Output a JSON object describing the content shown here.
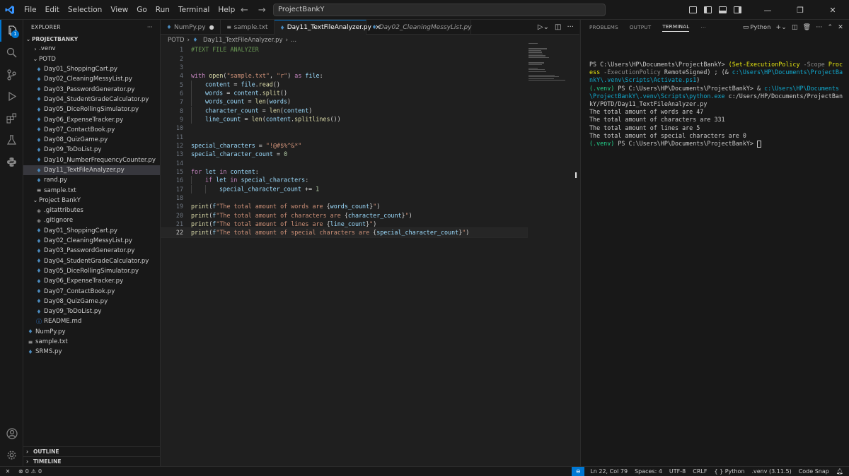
{
  "titlebar": {
    "menus": [
      "File",
      "Edit",
      "Selection",
      "View",
      "Go",
      "Run",
      "Terminal",
      "Help"
    ],
    "search": "ProjectBankY",
    "back_icon": "←",
    "forward_icon": "→"
  },
  "activity": {
    "badge": "1"
  },
  "explorer": {
    "header": "EXPLORER",
    "more": "···",
    "root": "PROJECTBANKY",
    "items": [
      {
        "label": ".venv",
        "indent": 1,
        "type": "folder",
        "open": false
      },
      {
        "label": "POTD",
        "indent": 1,
        "type": "folder",
        "open": true
      },
      {
        "label": "Day01_ShoppingCart.py",
        "indent": 2,
        "type": "py"
      },
      {
        "label": "Day02_CleaningMessyList.py",
        "indent": 2,
        "type": "py"
      },
      {
        "label": "Day03_PasswordGenerator.py",
        "indent": 2,
        "type": "py"
      },
      {
        "label": "Day04_StudentGradeCalculator.py",
        "indent": 2,
        "type": "py"
      },
      {
        "label": "Day05_DiceRollingSimulator.py",
        "indent": 2,
        "type": "py"
      },
      {
        "label": "Day06_ExpenseTracker.py",
        "indent": 2,
        "type": "py"
      },
      {
        "label": "Day07_ContactBook.py",
        "indent": 2,
        "type": "py"
      },
      {
        "label": "Day08_QuizGame.py",
        "indent": 2,
        "type": "py"
      },
      {
        "label": "Day09_ToDoList.py",
        "indent": 2,
        "type": "py"
      },
      {
        "label": "Day10_NumberFrequencyCounter.py",
        "indent": 2,
        "type": "py"
      },
      {
        "label": "Day11_TextFileAnalyzer.py",
        "indent": 2,
        "type": "py",
        "selected": true
      },
      {
        "label": "rand.py",
        "indent": 2,
        "type": "py"
      },
      {
        "label": "sample.txt",
        "indent": 2,
        "type": "txt"
      },
      {
        "label": "Project BankY",
        "indent": 1,
        "type": "folder",
        "open": true
      },
      {
        "label": ".gitattributes",
        "indent": 2,
        "type": "git"
      },
      {
        "label": ".gitignore",
        "indent": 2,
        "type": "git"
      },
      {
        "label": "Day01_ShoppingCart.py",
        "indent": 2,
        "type": "py"
      },
      {
        "label": "Day02_CleaningMessyList.py",
        "indent": 2,
        "type": "py"
      },
      {
        "label": "Day03_PasswordGenerator.py",
        "indent": 2,
        "type": "py"
      },
      {
        "label": "Day04_StudentGradeCalculator.py",
        "indent": 2,
        "type": "py"
      },
      {
        "label": "Day05_DiceRollingSimulator.py",
        "indent": 2,
        "type": "py"
      },
      {
        "label": "Day06_ExpenseTracker.py",
        "indent": 2,
        "type": "py"
      },
      {
        "label": "Day07_ContactBook.py",
        "indent": 2,
        "type": "py"
      },
      {
        "label": "Day08_QuizGame.py",
        "indent": 2,
        "type": "py"
      },
      {
        "label": "Day09_ToDoList.py",
        "indent": 2,
        "type": "py"
      },
      {
        "label": "README.md",
        "indent": 2,
        "type": "info"
      },
      {
        "label": "NumPy.py",
        "indent": 0,
        "type": "py"
      },
      {
        "label": "sample.txt",
        "indent": 0,
        "type": "txt"
      },
      {
        "label": "SRMS.py",
        "indent": 0,
        "type": "py"
      }
    ],
    "outline": "OUTLINE",
    "timeline": "TIMELINE"
  },
  "tabs": [
    {
      "label": "NumPy.py",
      "state": "modified"
    },
    {
      "label": "sample.txt",
      "state": "normal",
      "icon": "txt"
    },
    {
      "label": "Day11_TextFileAnalyzer.py",
      "state": "active"
    },
    {
      "label": "Day02_CleaningMessyList.py",
      "state": "preview"
    }
  ],
  "breadcrumb": {
    "folder": "POTD",
    "file": "Day11_TextFileAnalyzer.py",
    "symbol": "..."
  },
  "code": {
    "current_line": 22,
    "lines": [
      [
        [
          "cmt",
          "#TEXT FILE ANALYZER"
        ]
      ],
      [],
      [],
      [
        [
          "kw",
          "with "
        ],
        [
          "fn",
          "open"
        ],
        [
          "op",
          "("
        ],
        [
          "str",
          "\"sample.txt\""
        ],
        [
          "op",
          ", "
        ],
        [
          "str",
          "\"r\""
        ],
        [
          "op",
          ") "
        ],
        [
          "kw",
          "as "
        ],
        [
          "var",
          "file"
        ],
        [
          "op",
          ":"
        ]
      ],
      [
        [
          "g",
          ""
        ],
        [
          "var",
          "content"
        ],
        [
          "op",
          " = "
        ],
        [
          "var",
          "file"
        ],
        [
          "op",
          "."
        ],
        [
          "fn",
          "read"
        ],
        [
          "op",
          "()"
        ]
      ],
      [
        [
          "g",
          ""
        ],
        [
          "var",
          "words"
        ],
        [
          "op",
          " = "
        ],
        [
          "var",
          "content"
        ],
        [
          "op",
          "."
        ],
        [
          "fn",
          "split"
        ],
        [
          "op",
          "()"
        ]
      ],
      [
        [
          "g",
          ""
        ],
        [
          "var",
          "words_count"
        ],
        [
          "op",
          " = "
        ],
        [
          "fn",
          "len"
        ],
        [
          "op",
          "("
        ],
        [
          "var",
          "words"
        ],
        [
          "op",
          ")"
        ]
      ],
      [
        [
          "g",
          ""
        ],
        [
          "var",
          "character_count"
        ],
        [
          "op",
          " = "
        ],
        [
          "fn",
          "len"
        ],
        [
          "op",
          "("
        ],
        [
          "var",
          "content"
        ],
        [
          "op",
          ")"
        ]
      ],
      [
        [
          "g",
          ""
        ],
        [
          "var",
          "line_count"
        ],
        [
          "op",
          " = "
        ],
        [
          "fn",
          "len"
        ],
        [
          "op",
          "("
        ],
        [
          "var",
          "content"
        ],
        [
          "op",
          "."
        ],
        [
          "fn",
          "splitlines"
        ],
        [
          "op",
          "())"
        ]
      ],
      [],
      [],
      [
        [
          "var",
          "special_characters"
        ],
        [
          "op",
          " = "
        ],
        [
          "str",
          "\"!@#$%^&*\""
        ]
      ],
      [
        [
          "var",
          "special_character_count"
        ],
        [
          "op",
          " = "
        ],
        [
          "num",
          "0"
        ]
      ],
      [],
      [
        [
          "kw",
          "for "
        ],
        [
          "var",
          "let "
        ],
        [
          "kw",
          "in "
        ],
        [
          "var",
          "content"
        ],
        [
          "op",
          ":"
        ]
      ],
      [
        [
          "g",
          ""
        ],
        [
          "kw",
          "if "
        ],
        [
          "var",
          "let "
        ],
        [
          "kw",
          "in "
        ],
        [
          "var",
          "special_characters"
        ],
        [
          "op",
          ":"
        ]
      ],
      [
        [
          "g",
          ""
        ],
        [
          "g",
          ""
        ],
        [
          "var",
          "special_character_count"
        ],
        [
          "op",
          " += "
        ],
        [
          "num",
          "1"
        ]
      ],
      [],
      [
        [
          "fn",
          "print"
        ],
        [
          "op",
          "("
        ],
        [
          "var",
          "f"
        ],
        [
          "str",
          "\"The total amount of words are "
        ],
        [
          "op",
          "{"
        ],
        [
          "var",
          "words_count"
        ],
        [
          "op",
          "}"
        ],
        [
          "str",
          "\""
        ],
        [
          "op",
          ")"
        ]
      ],
      [
        [
          "fn",
          "print"
        ],
        [
          "op",
          "("
        ],
        [
          "var",
          "f"
        ],
        [
          "str",
          "\"The total amount of characters are "
        ],
        [
          "op",
          "{"
        ],
        [
          "var",
          "character_count"
        ],
        [
          "op",
          "}"
        ],
        [
          "str",
          "\""
        ],
        [
          "op",
          ")"
        ]
      ],
      [
        [
          "fn",
          "print"
        ],
        [
          "op",
          "("
        ],
        [
          "var",
          "f"
        ],
        [
          "str",
          "\"The total amount of lines are "
        ],
        [
          "op",
          "{"
        ],
        [
          "var",
          "line_count"
        ],
        [
          "op",
          "}"
        ],
        [
          "str",
          "\""
        ],
        [
          "op",
          ")"
        ]
      ],
      [
        [
          "fn",
          "print"
        ],
        [
          "op",
          "("
        ],
        [
          "var",
          "f"
        ],
        [
          "str",
          "\"The total amount of special characters are "
        ],
        [
          "op",
          "{"
        ],
        [
          "var",
          "special_character_count"
        ],
        [
          "op",
          "}"
        ],
        [
          "str",
          "\""
        ],
        [
          "op",
          ")"
        ]
      ]
    ]
  },
  "panel": {
    "tabs": [
      "PROBLEMS",
      "OUTPUT",
      "TERMINAL",
      "···"
    ],
    "active_tab": "TERMINAL",
    "shell_label": "Python",
    "terminal": [
      [
        [
          "n",
          "PS C:\\Users\\HP\\Documents\\ProjectBankY> "
        ],
        [
          "y",
          "(Set-ExecutionPolicy "
        ],
        [
          "g",
          "-Scope "
        ],
        [
          "y",
          "Process "
        ],
        [
          "g",
          "-ExecutionPolicy "
        ],
        [
          "n",
          "RemoteSigned) ; (& "
        ],
        [
          "c",
          "c:\\Users\\HP\\Documents\\ProjectBankY\\.venv\\Scripts\\Activate.ps1"
        ],
        [
          "n",
          ")"
        ]
      ],
      [
        [
          "gr",
          "(.venv) "
        ],
        [
          "n",
          "PS C:\\Users\\HP\\Documents\\ProjectBankY> & "
        ],
        [
          "c",
          "c:\\Users\\HP\\Documents\\ProjectBankY\\.venv\\Scripts\\python.exe "
        ],
        [
          "n",
          "c:/Users/HP/Documents/ProjectBankY/POTD/Day11_TextFileAnalyzer.py"
        ]
      ],
      [
        [
          "n",
          "The total amount of words are 47"
        ]
      ],
      [
        [
          "n",
          "The total amount of characters are 331"
        ]
      ],
      [
        [
          "n",
          "The total amount of lines are 5"
        ]
      ],
      [
        [
          "n",
          "The total amount of special characters are 0"
        ]
      ],
      [
        [
          "gr",
          "(.venv) "
        ],
        [
          "n",
          "PS C:\\Users\\HP\\Documents\\ProjectBankY> "
        ],
        [
          "cursor",
          ""
        ]
      ]
    ]
  },
  "status": {
    "errors": "0",
    "warnings": "0",
    "position": "Ln 22, Col 79",
    "spaces": "Spaces: 4",
    "encoding": "UTF-8",
    "eol": "CRLF",
    "language": "{ } Python",
    "interpreter": ".venv (3.11.5)",
    "extension": "Code Snap"
  },
  "colors": {
    "accent": "#0078d4",
    "python_icon": "#4b8bbe"
  }
}
